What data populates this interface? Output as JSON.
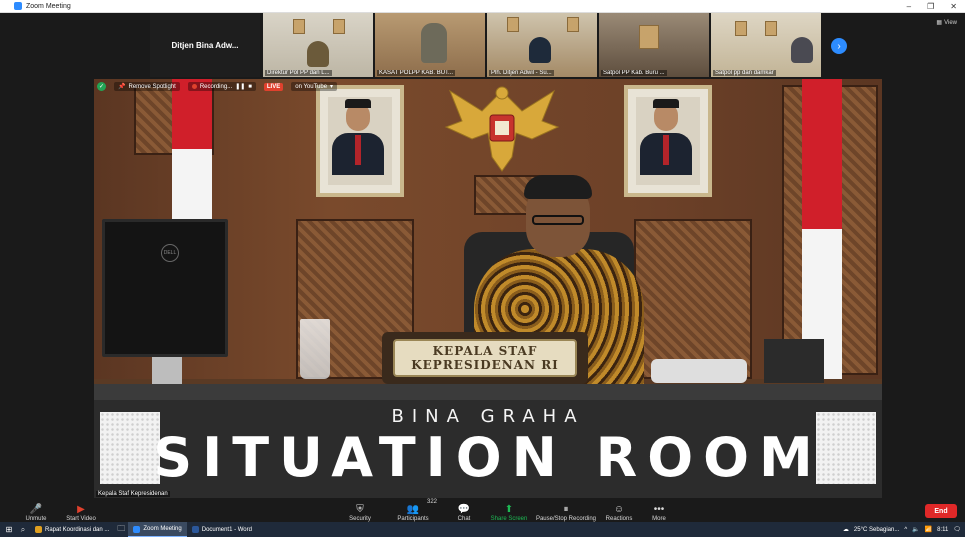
{
  "window": {
    "title": "Zoom Meeting",
    "controls": [
      "–",
      "❐",
      "✕"
    ]
  },
  "gallery": {
    "namecard": "Ditjen Bina Adw...",
    "tiles": [
      {
        "name": "Direktur Pol PP dan L..."
      },
      {
        "name": "KASAT POLPP KAB. BUT..."
      },
      {
        "name": "Plh. Ditjen Adwil - Su..."
      },
      {
        "name": "Satpol PP Kab. Buru ..."
      },
      {
        "name": "Satpol pp dan damkar"
      }
    ],
    "view_label": "View",
    "next_arrow": "›"
  },
  "spotlight": {
    "shield_glyph": "✓",
    "remove_spotlight": "Remove Spotlight",
    "recording": "Recording...",
    "live_badge": "LIVE",
    "live_on": "on YouTube",
    "nameplate_line1": "KEPALA STAF",
    "nameplate_line2": "KEPRESIDENAN RI",
    "sign_line1": "BINA GRAHA",
    "sign_line2": "SITUATION ROOM",
    "participant_name": "Kepala Staf Kepresidenan",
    "monitor_logo": "DELL"
  },
  "toolbar": {
    "unmute": "Unmute",
    "start_video": "Start Video",
    "security": "Security",
    "participants": "Participants",
    "participants_count": "322",
    "chat": "Chat",
    "share_screen": "Share Screen",
    "pause_recording": "Pause/Stop Recording",
    "reactions": "Reactions",
    "more": "More",
    "end": "End",
    "colors": {
      "share": "#1db954",
      "end": "#e02828"
    }
  },
  "taskbar": {
    "apps": [
      {
        "label": "Rapat Koordinasi dan ...",
        "color": "#e0a020"
      },
      {
        "label": "Zoom Meeting",
        "color": "#2d8cff"
      },
      {
        "label": "Document1 - Word",
        "color": "#2b579a"
      }
    ],
    "weather": "25°C  Sebagian...",
    "time": "8:11"
  }
}
